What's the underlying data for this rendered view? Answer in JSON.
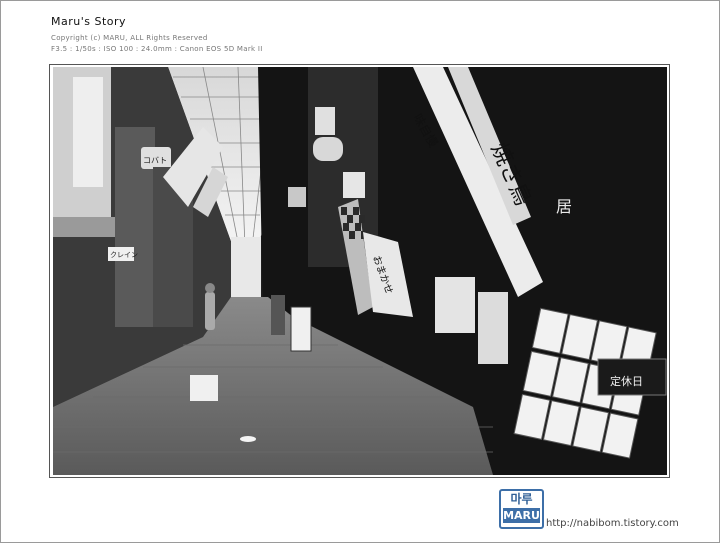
{
  "header": {
    "title": "Maru's Story",
    "copyright": "Copyright (c) MARU, ALL Rights Reserved",
    "exif": "F3.5 : 1/50s : ISO 100 : 24.0mm : Canon EOS 5D Mark II"
  },
  "photo": {
    "subject": "",
    "banner_left_1": "",
    "banner_right_big": "焼き鳥",
    "banner_right_top": "味自慢",
    "sign_mid": "おまかせ",
    "sign_closed": "定休日",
    "sign_koshitsu": "居",
    "sign_kohito": "コバト",
    "sign_store_left": "クレイン"
  },
  "footer": {
    "logo_top": "마루",
    "logo_bottom": "MARU",
    "url": "http://nabibom.tistory.com"
  }
}
